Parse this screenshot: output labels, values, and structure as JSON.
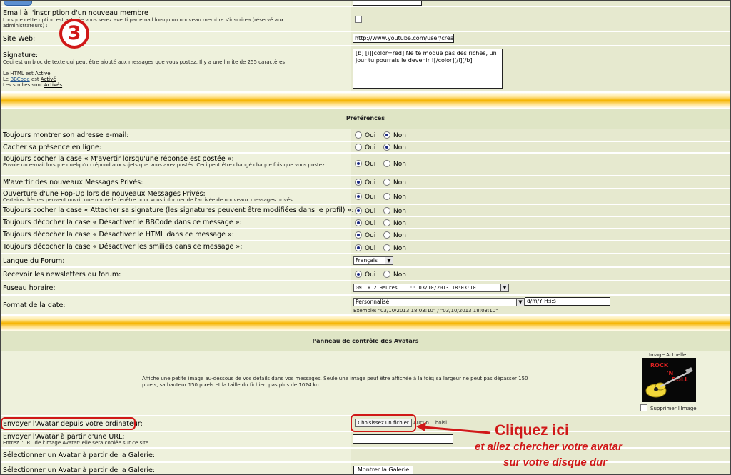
{
  "profile": {
    "email_notify_label": "Email à l'inscription d'un nouveau membre",
    "email_notify_sub": "Lorsque cette option est activée vous serez averti par email lorsqu'un nouveau membre s'inscrirea (réservé aux administrateurs) :",
    "website_label": "Site Web:",
    "website_value": "http://www.youtube.com/user/crea",
    "signature_label": "Signature:",
    "signature_sub": "Ceci est un bloc de texte qui peut être ajouté aux messages que vous postez. Il y a une limite de 255 caractères",
    "signature_value": "[b] [i][color=red] Ne te moque pas des riches, un jour tu pourrais le devenir ![/color][/i][/b]",
    "html_prefix": "Le HTML est",
    "bbcode_prefix": "Le",
    "bbcode_word": "BBCode",
    "bbcode_mid": "est",
    "smilies_prefix": "Les smilies sont",
    "active": "Activé",
    "active_pl": "Activés"
  },
  "step_number": "3",
  "prefs": {
    "title": "Préférences",
    "oui": "Oui",
    "non": "Non",
    "items": [
      {
        "label": "Toujours montrer son adresse e-mail:",
        "sub": "",
        "value": "Non"
      },
      {
        "label": "Cacher sa présence en ligne:",
        "sub": "",
        "value": "Non"
      },
      {
        "label": "Toujours cocher la case « M'avertir lorsqu'une réponse est postée »:",
        "sub": "Envoie un e-mail lorsque quelqu'un répond aux sujets que vous avez postés. Ceci peut être changé chaque fois que vous postez.",
        "value": "Oui"
      },
      {
        "label": "M'avertir des nouveaux Messages Privés:",
        "sub": "",
        "value": "Oui"
      },
      {
        "label": "Ouverture d'une Pop-Up lors de nouveaux Messages Privés:",
        "sub": "Certains thèmes peuvent ouvrir une nouvelle fenêtre pour vous informer de l'arrivée de nouveaux messages privés",
        "value": "Oui"
      },
      {
        "label": "Toujours cocher la case « Attacher sa signature (les signatures peuvent être modifiées dans le profil) »:",
        "sub": "",
        "value": "Oui"
      },
      {
        "label": "Toujours décocher la case « Désactiver le BBCode dans ce message »:",
        "sub": "",
        "value": "Oui"
      },
      {
        "label": "Toujours décocher la case « Désactiver le HTML dans ce message »:",
        "sub": "",
        "value": "Oui"
      },
      {
        "label": "Toujours décocher la case « Désactiver les smilies dans ce message »:",
        "sub": "",
        "value": "Oui"
      }
    ],
    "lang_label": "Langue du Forum:",
    "lang_value": "Français",
    "newsletter_label": "Recevoir les newsletters du forum:",
    "newsletter_value": "Oui",
    "tz_label": "Fuseau horaire:",
    "tz_value": "GMT + 2 Heures    :: 03/10/2013 18:03:10",
    "date_label": "Format de la date:",
    "date_select": "Personnalisé",
    "date_custom": "d/m/Y H:i:s",
    "date_example": "Exemple: \"03/10/2013 18:03:10\" / \"03/10/2013 18:03:10\""
  },
  "avatar": {
    "title": "Panneau de contrôle des Avatars",
    "current_label": "Image Actuelle",
    "description": "Affiche une petite image au-dessous de vos détails dans vos messages. Seule une image peut être affichée à la fois; sa largeur ne peut pas dépasser 150 pixels, sa hauteur 150 pixels et la taille du fichier, pas plus de 1024 ko.",
    "avatar_text_top": "ROCK",
    "avatar_text_mid": "'N",
    "avatar_text_bottom": "ROLL",
    "delete_label": "Supprimer l'Image",
    "upload_label": "Envoyer l'Avatar depuis votre ordinateur:",
    "choose_button": "Choisissez un fichier",
    "no_file": "Aucun ...hoisi",
    "url_label": "Envoyer l'Avatar à partir d'une URL:",
    "url_sub": "Entrez l'URL de l'image Avatar: elle sera copiée sur ce site.",
    "gallery_label_1": "Sélectionner un Avatar à partir de la Galerie:",
    "gallery_label_2": "Sélectionner un Avatar à partir de la Galerie:",
    "gallery_button": "Montrer la Galerie"
  },
  "annotation": {
    "title": "Cliquez ici",
    "line1": "et allez chercher votre avatar",
    "line2": "sur votre disque dur",
    "color": "#d01818"
  },
  "colors": {
    "left_cell": "#eef1dc",
    "right_cell": "#e6e9cf",
    "gold": "#f5b400",
    "section": "#dfe5c5"
  }
}
